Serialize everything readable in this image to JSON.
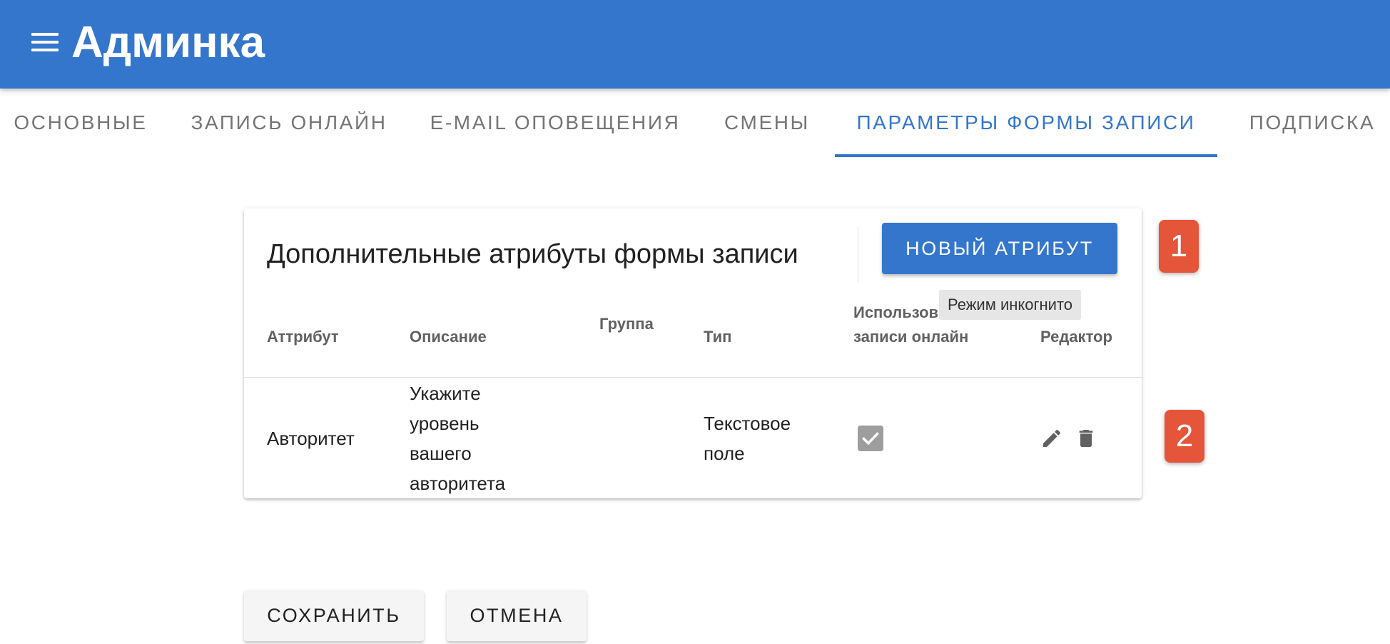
{
  "app": {
    "title": "Админка"
  },
  "tabs": [
    {
      "label": "Основные",
      "active": false
    },
    {
      "label": "Запись онлайн",
      "active": false
    },
    {
      "label": "E-mail оповещения",
      "active": false
    },
    {
      "label": "Смены",
      "active": false
    },
    {
      "label": "Параметры формы записи",
      "active": true
    },
    {
      "label": "Подписка",
      "active": false
    }
  ],
  "card": {
    "title": "Дополнительные атрибуты формы записи",
    "new_button": "НОВЫЙ АТРИБУТ",
    "tooltip": "Режим инкогнито",
    "columns": {
      "attribute": "Аттрибут",
      "description": "Описание",
      "group": "Группа",
      "type": "Тип",
      "usage_line1": "Использов",
      "usage_line2": "записи онлайн",
      "editor": "Редактор"
    },
    "rows": [
      {
        "attribute": "Авторитет",
        "description_lines": [
          "Укажите",
          "уровень",
          "вашего",
          "авторитета"
        ],
        "group": "",
        "type_lines": [
          "Текстовое",
          "поле"
        ],
        "used_online": true
      }
    ]
  },
  "badges": {
    "first": "1",
    "second": "2"
  },
  "actions": {
    "save": "СОХРАНИТЬ",
    "cancel": "ОТМЕНА"
  },
  "colors": {
    "primary": "#3476cc",
    "badge": "#e5553a",
    "checkbox": "#9e9e9e"
  },
  "icons": {
    "menu": "menu-icon",
    "edit": "pencil-icon",
    "delete": "trash-icon",
    "check": "check-icon"
  }
}
